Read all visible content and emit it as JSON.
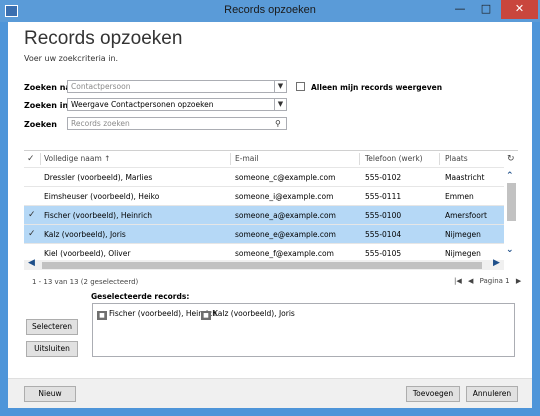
{
  "window": {
    "title": "Records opzoeken"
  },
  "header": {
    "title": "Records opzoeken",
    "subtitle": "Voer uw zoekcriteria in."
  },
  "form": {
    "zoeken_naar": {
      "label": "Zoeken naar",
      "value": "Contactpersoon"
    },
    "zoeken_in": {
      "label": "Zoeken in",
      "value": "Weergave Contactpersonen opzoeken"
    },
    "zoeken": {
      "label": "Zoeken",
      "placeholder": "Records zoeken"
    },
    "only_mine": {
      "label": "Alleen mijn records weergeven",
      "checked": false
    }
  },
  "grid": {
    "columns": [
      "Volledige naam",
      "E-mail",
      "Telefoon (werk)",
      "Plaats"
    ],
    "sort_indicator": "↑",
    "rows": [
      {
        "name": "Dressler (voorbeeld), Marlies",
        "email": "someone_c@example.com",
        "phone": "555-0102",
        "city": "Maastricht",
        "selected": false
      },
      {
        "name": "Eimsheuser (voorbeeld), Heiko",
        "email": "someone_i@example.com",
        "phone": "555-0111",
        "city": "Emmen",
        "selected": false
      },
      {
        "name": "Fischer (voorbeeld), Heinrich",
        "email": "someone_a@example.com",
        "phone": "555-0100",
        "city": "Amersfoort",
        "selected": true
      },
      {
        "name": "Kalz (voorbeeld), Joris",
        "email": "someone_e@example.com",
        "phone": "555-0104",
        "city": "Nijmegen",
        "selected": true
      },
      {
        "name": "Kiel (voorbeeld), Oliver",
        "email": "someone_f@example.com",
        "phone": "555-0105",
        "city": "Nijmegen",
        "selected": false
      }
    ]
  },
  "status": {
    "text": "1 - 13  van 13 (2 geselecteerd)"
  },
  "pager": {
    "first": "|◀",
    "prev": "◀",
    "page": "Pagina 1",
    "next": "▶"
  },
  "selected": {
    "title": "Geselecteerde records:",
    "items": [
      "Fischer (voorbeeld), Heinrich",
      "Kalz (voorbeeld), Joris"
    ]
  },
  "buttons": {
    "select": "Selecteren",
    "exclude": "Uitsluiten",
    "new": "Nieuw",
    "add": "Toevoegen",
    "cancel": "Annuleren"
  },
  "colors": {
    "accent": "#4e95d9",
    "selection": "#b5d8f6",
    "close": "#c9463d"
  },
  "icons": [
    "app-icon",
    "minimize-icon",
    "maximize-icon",
    "close-icon",
    "dropdown-icon",
    "search-icon",
    "checkmark-icon",
    "sort-up-icon",
    "refresh-icon",
    "contact-card-icon"
  ]
}
